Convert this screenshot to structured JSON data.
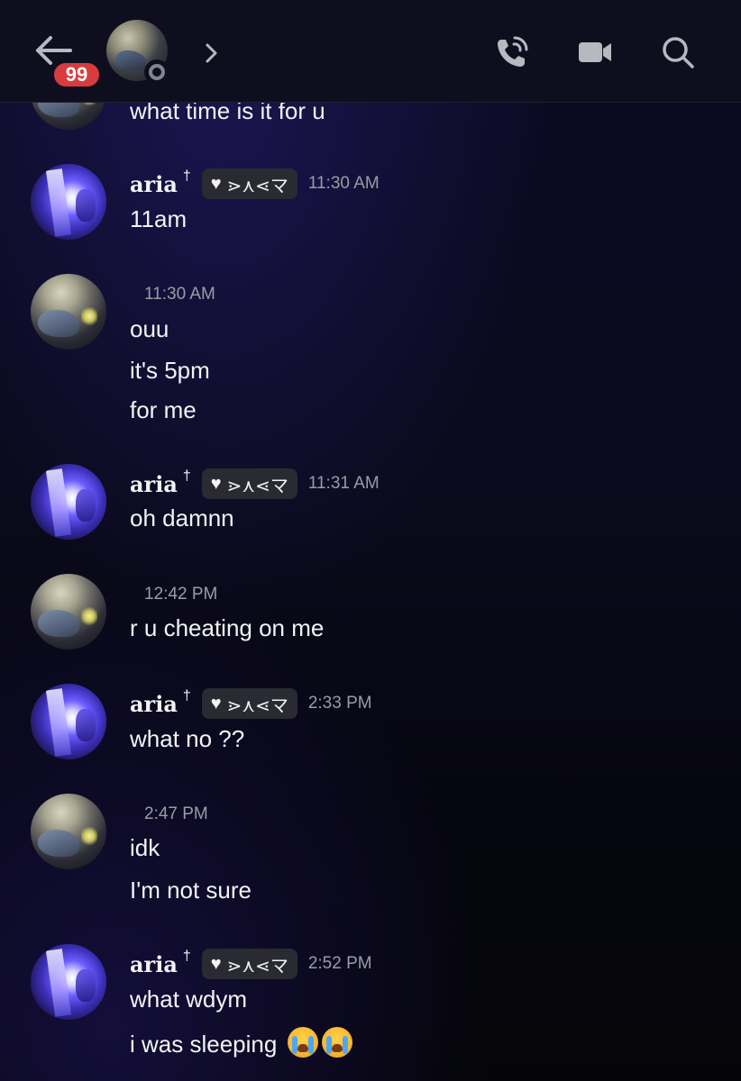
{
  "header": {
    "unread_badge": "99",
    "icons": [
      "back-arrow-icon",
      "chevron-right-icon",
      "phone-call-icon",
      "video-camera-icon",
      "search-icon"
    ]
  },
  "colors": {
    "badge": "#d83c3e",
    "timestamp": "#9a9ca4",
    "text": "#f2f3f5",
    "tag_chip": "#2a2a33"
  },
  "messages": {
    "partial_text": "what time is it for u",
    "g1": {
      "author": "aria",
      "dagger": "†",
      "tag": "⋗⋏⋖マ",
      "time": "11:30 AM",
      "lines": [
        "11am"
      ]
    },
    "g2": {
      "time": "11:30 AM",
      "lines": [
        "ouu",
        "it's 5pm",
        "for me"
      ]
    },
    "g3": {
      "author": "aria",
      "dagger": "†",
      "tag": "⋗⋏⋖マ",
      "time": "11:31 AM",
      "lines": [
        "oh damnn"
      ]
    },
    "g4": {
      "time": "12:42 PM",
      "lines": [
        "r u cheating on me"
      ]
    },
    "g5": {
      "author": "aria",
      "dagger": "†",
      "tag": "⋗⋏⋖マ",
      "time": "2:33 PM",
      "lines": [
        "what no ??"
      ]
    },
    "g6": {
      "time": "2:47 PM",
      "lines": [
        "idk",
        "I'm not sure"
      ]
    },
    "g7": {
      "author": "aria",
      "dagger": "†",
      "tag": "⋗⋏⋖マ",
      "time": "2:52 PM",
      "lines": [
        "what wdym",
        "i was sleeping"
      ],
      "emoji": "loudly-crying-face"
    }
  }
}
